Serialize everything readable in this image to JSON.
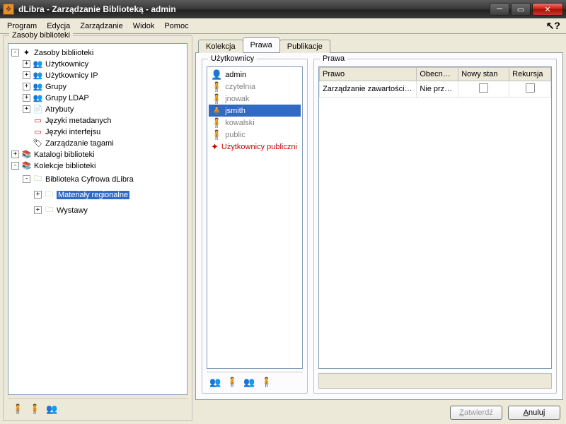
{
  "window": {
    "title": "dLibra - Zarządzanie Biblioteką - admin"
  },
  "menu": {
    "items": [
      "Program",
      "Edycja",
      "Zarządzanie",
      "Widok",
      "Pomoc"
    ]
  },
  "leftPanel": {
    "legend": "Zasoby biblioteki"
  },
  "tree": {
    "root": "Zasoby bibliioteki",
    "users": "Użytkownicy",
    "usersIP": "Użytkownicy IP",
    "groups": "Grupy",
    "groupsLDAP": "Grupy LDAP",
    "attrs": "Atrybuty",
    "langMeta": "Języki metadanych",
    "langUI": "Języki interfejsu",
    "tags": "Zarządzanie tagami",
    "catalogs": "Katalogi biblioteki",
    "collections": "Kolekcje biblioteki",
    "digLib": "Biblioteka Cyfrowa dLibra",
    "regional": "Materiały regionalne",
    "exhib": "Wystawy"
  },
  "tabs": {
    "t1": "Kolekcja",
    "t2": "Prawa",
    "t3": "Publikacje"
  },
  "usersPanel": {
    "legend": "Użytkownicy"
  },
  "users": {
    "u0": "admin",
    "u1": "czytelnia",
    "u2": "jnowak",
    "u3": "jsmith",
    "u4": "kowalski",
    "u5": "public",
    "u6": "Użytkownicy publiczni"
  },
  "rightsPanel": {
    "legend": "Prawa"
  },
  "rightsTable": {
    "h0": "Prawo",
    "h1": "Obecn…",
    "h2": "Nowy stan",
    "h3": "Rekursja",
    "r0c0": "Zarządzanie zawartością kole…",
    "r0c1": "Nie przy…"
  },
  "buttons": {
    "ok": "atwierdź",
    "okU": "Z",
    "cancel": "nuluj",
    "cancelU": "A"
  }
}
